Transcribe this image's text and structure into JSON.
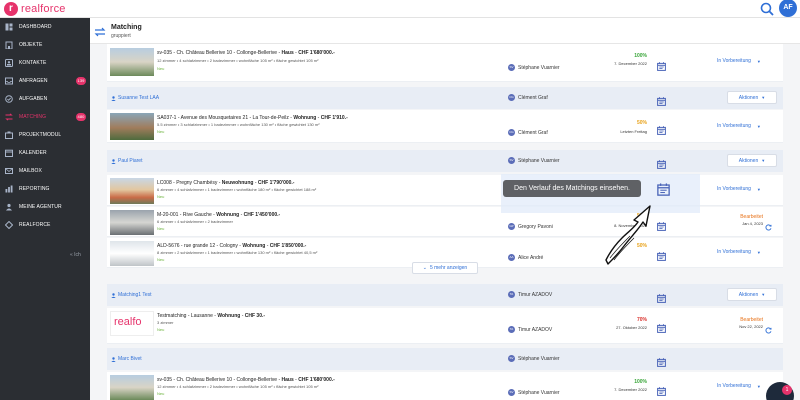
{
  "app": {
    "logo_letter": "r",
    "logo_text": "realforce"
  },
  "user": {
    "initials": "AF"
  },
  "sidebar": {
    "items": [
      {
        "label": "DASHBOARD",
        "icon": "dashboard-icon",
        "badge": ""
      },
      {
        "label": "OBJEKTE",
        "icon": "building-icon",
        "badge": ""
      },
      {
        "label": "KONTAKTE",
        "icon": "contact-icon",
        "badge": ""
      },
      {
        "label": "ANFRAGEN",
        "icon": "inbox-icon",
        "badge": "139"
      },
      {
        "label": "AUFGABEN",
        "icon": "tasks-icon",
        "badge": ""
      },
      {
        "label": "MATCHING",
        "icon": "matching-icon",
        "badge": "480"
      },
      {
        "label": "PROJEKTMODUL",
        "icon": "project-icon",
        "badge": ""
      },
      {
        "label": "KALENDER",
        "icon": "calendar-icon",
        "badge": ""
      },
      {
        "label": "MAILBOX",
        "icon": "mail-icon",
        "badge": ""
      },
      {
        "label": "REPORTING",
        "icon": "chart-icon",
        "badge": ""
      },
      {
        "label": "MEINE AGENTUR",
        "icon": "agency-icon",
        "badge": ""
      },
      {
        "label": "REALFORCE",
        "icon": "realforce-icon",
        "badge": ""
      }
    ],
    "collapse_label": "« Ich"
  },
  "header": {
    "title": "Matching",
    "subtitle": "gruppiert"
  },
  "groups": [
    {
      "user": "",
      "agent": ""
    },
    {
      "user": "Susanne Test LAA",
      "agent_initials": "CG",
      "agent": "Clément Graf",
      "actions": "Aktionen"
    },
    {
      "user": "Paul Piaret",
      "agent_initials": "SV",
      "agent": "Stéphane Vuarnier",
      "actions": "Aktionen"
    },
    {
      "user": "Matching1 Test",
      "agent_initials": "TA",
      "agent": "Timur AZADOV",
      "actions": "Aktionen"
    },
    {
      "user": "Marc Bivet",
      "agent_initials": "SV",
      "agent": "Stéphane Vuarnier",
      "actions": ""
    }
  ],
  "rows": [
    {
      "ref": "sv-035",
      "address": "Ch. Château Bellerive 10 - Collonge-Bellerive",
      "type": "Haus",
      "price": "CHF 1'680'000.-",
      "details": "12 zimmer • 4 schlafzimmer • 2 badezimmer • wohnfläche 105 m² • fläche gewichtet 105 m²",
      "status": "Neu",
      "agent_initials": "SV",
      "agent": "Stéphane Vuarnier",
      "percent": "100%",
      "percent_color": "#3aa63a",
      "date": "7. December 2022",
      "state": "In Vorbereitung",
      "state_sub": ""
    },
    {
      "ref": "SA037-1",
      "address": "Avenue des Mousquetaires 21 - La Tour-de-Peilz",
      "type": "Wohnung",
      "price": "CHF 1'910.-",
      "details": "5.5 zimmer • 3 schlafzimmer • 1 badezimmer • wohnfläche 130 m² • fläche gewichtet 130 m²",
      "status": "Neu",
      "agent_initials": "CG",
      "agent": "Clément Graf",
      "percent": "50%",
      "percent_color": "#e8a21a",
      "date": "Letzten Freitag",
      "state": "In Vorbereitung",
      "state_sub": ""
    },
    {
      "ref": "LC008",
      "address": "Pregny Chambésy",
      "type": "Neuwohnung",
      "price": "CHF 1'790'000.-",
      "details": "6 zimmer • 4 schlafzimmer • 1 badezimmer • wohnfläche 180 m² • fläche gewichtet 188 m²",
      "status": "Neu",
      "agent_initials": "",
      "agent": "",
      "percent": "",
      "percent_color": "#3aa63a",
      "date": "",
      "state": "In Vorbereitung",
      "state_sub": ""
    },
    {
      "ref": "M-20-001",
      "address": "Rive Gauche",
      "type": "Wohnung",
      "price": "CHF 1'450'000.-",
      "details": "6 zimmer • 4 schlafzimmer • 2 badezimmer",
      "status": "Neu",
      "agent_initials": "GP",
      "agent": "Gregory Pavoni",
      "percent": "50%",
      "percent_color": "#e8a21a",
      "date": "8. November 2022",
      "state": "Bearbeitet",
      "state_sub": "Jan 4, 2023"
    },
    {
      "ref": "ALD-5676",
      "address": "rue grande 12 - Cologny",
      "type": "Wohnung",
      "price": "CHF 1'850'000.-",
      "details": "8 zimmer • 2 schlafzimmer • 1 badezimmer • wohnfläche 130 m² • fläche gewichtet 40,5 m²",
      "status": "Neu",
      "agent_initials": "AA",
      "agent": "Alice André",
      "percent": "50%",
      "percent_color": "#e8a21a",
      "date": "",
      "state": "In Vorbereitung",
      "state_sub": ""
    },
    {
      "ref": "Testmatching",
      "address": "Lausanne",
      "type": "Wohnung",
      "price": "CHF 30.-",
      "details": "3 zimmer",
      "status": "Neu",
      "agent_initials": "TA",
      "agent": "Timur AZADOV",
      "percent": "70%",
      "percent_color": "#d9302b",
      "date": "27. Oktober 2022",
      "state": "Bearbeitet",
      "state_sub": "Nov 22, 2022"
    },
    {
      "ref": "sv-035",
      "address": "Ch. Château Bellerive 10 - Collonge-Bellerive",
      "type": "Haus",
      "price": "CHF 1'680'000.-",
      "details": "12 zimmer • 4 schlafzimmer • 2 badezimmer • wohnfläche 105 m² • fläche gewichtet 105 m²",
      "status": "Neu",
      "agent_initials": "SV",
      "agent": "Stéphane Vuarnier",
      "percent": "100%",
      "percent_color": "#3aa63a",
      "date": "7. December 2022",
      "state": "In Vorbereitung",
      "state_sub": ""
    }
  ],
  "more_button": "5 mehr anzeigen",
  "tooltip": "Den Verlauf des Matchings einsehen.",
  "help_badge": "1",
  "logo_thumb_text": "realfo"
}
